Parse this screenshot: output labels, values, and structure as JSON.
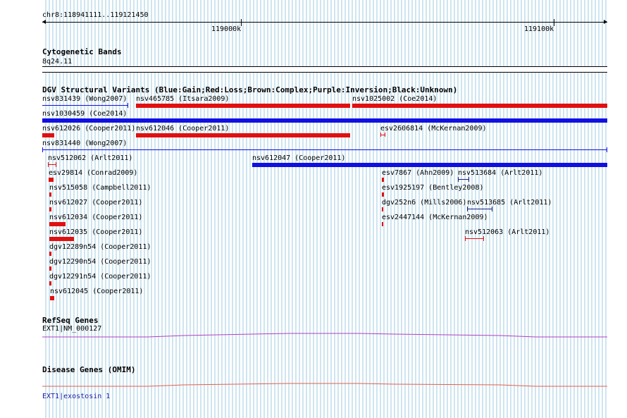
{
  "ruler": {
    "position": "chr8:118941111..119121450",
    "ticks": [
      "119000k",
      "119100k"
    ]
  },
  "cytoband": {
    "title": "Cytogenetic Bands",
    "band": "8q24.11"
  },
  "dgv": {
    "title": "DGV Structural Variants (Blue:Gain;Red:Loss;Brown:Complex;Purple:Inversion;Black:Unknown)",
    "variants": [
      "nsv831439 (Wong2007)",
      "nsv465785 (Itsara2009)",
      "nsv1025002 (Coe2014)",
      "nsv1030459 (Coe2014)",
      "nsv612026 (Cooper2011)",
      "nsv612046 (Cooper2011)",
      "esv2606814 (McKernan2009)",
      "nsv831440 (Wong2007)",
      "nsv512062 (Arlt2011)",
      "nsv612047 (Cooper2011)",
      "esv29814 (Conrad2009)",
      "esv7867 (Ahn2009)",
      "nsv513684 (Arlt2011)",
      "nsv515058 (Campbell2011)",
      "esv1925197 (Bentley2008)",
      "nsv612027 (Cooper2011)",
      "dgv252n6 (Mills2006)",
      "nsv513685 (Arlt2011)",
      "nsv612034 (Cooper2011)",
      "esv2447144 (McKernan2009)",
      "nsv612035 (Cooper2011)",
      "nsv512063 (Arlt2011)",
      "dgv12289n54 (Cooper2011)",
      "dgv12290n54 (Cooper2011)",
      "dgv12291n54 (Cooper2011)",
      "nsv612045 (Cooper2011)"
    ]
  },
  "refseq": {
    "title": "RefSeq Genes",
    "gene": "EXT1|NM_000127"
  },
  "omim": {
    "title": "Disease Genes (OMIM)",
    "gene_link": "EXT1|exostosin 1"
  },
  "colors": {
    "gain": "#1010e0",
    "loss": "#e01010",
    "grid": "#9ecbe0",
    "refseq_line": "#b040c0",
    "omim_line": "#e06050"
  }
}
